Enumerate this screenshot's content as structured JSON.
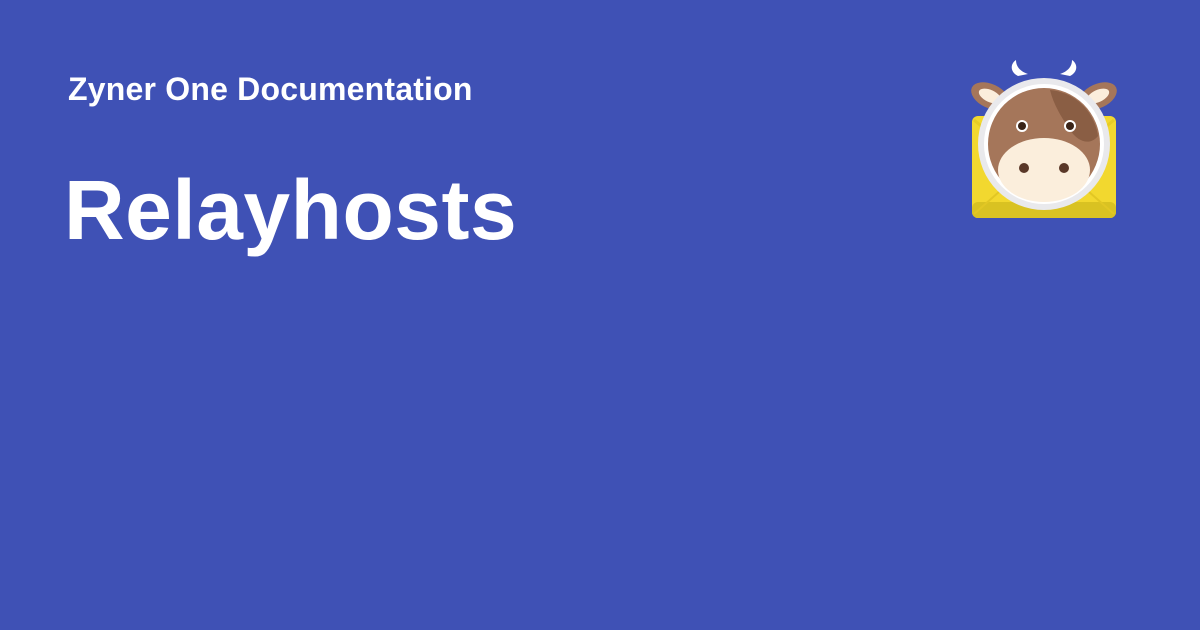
{
  "header": {
    "site_name": "Zyner One Documentation"
  },
  "page": {
    "title": "Relayhosts"
  },
  "logo": {
    "icon": "cow-envelope-logo-icon"
  },
  "colors": {
    "background": "#3f51b5",
    "text": "#ffffff",
    "envelope": "#f7e135",
    "cow_brown": "#a5765a",
    "cow_muzzle": "#fbeedc"
  }
}
